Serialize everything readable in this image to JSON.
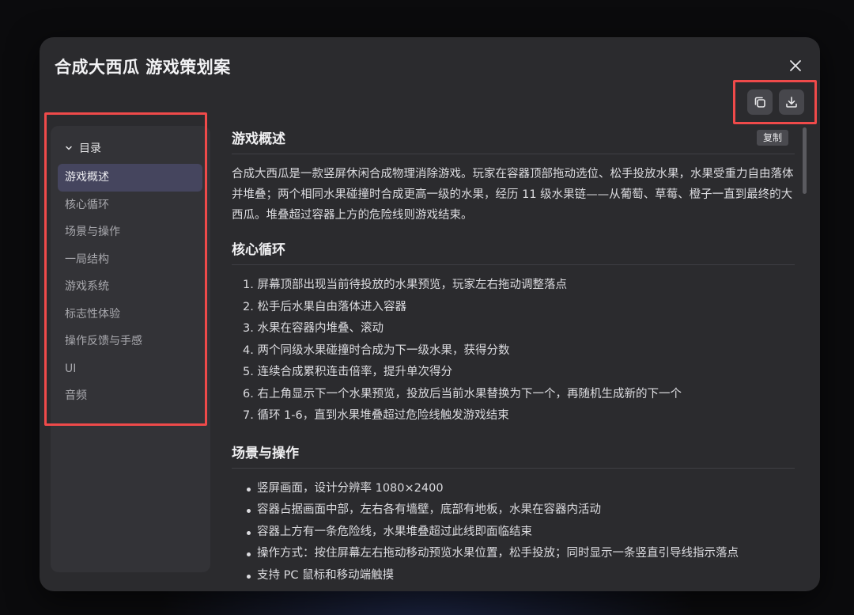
{
  "modal": {
    "title": "合成大西瓜 游戏策划案",
    "close_icon": "close-icon",
    "copy_icon": "copy-icon",
    "download_icon": "download-icon",
    "tooltip": "复制"
  },
  "toc": {
    "header": "目录",
    "items": [
      "游戏概述",
      "核心循环",
      "场景与操作",
      "一局结构",
      "游戏系统",
      "标志性体验",
      "操作反馈与手感",
      "UI",
      "音频"
    ],
    "active_index": 0
  },
  "content": {
    "sections": [
      {
        "heading": "游戏概述",
        "paragraph": "合成大西瓜是一款竖屏休闲合成物理消除游戏。玩家在容器顶部拖动选位、松手投放水果，水果受重力自由落体并堆叠；两个相同水果碰撞时合成更高一级的水果，经历 11 级水果链——从葡萄、草莓、橙子一直到最终的大西瓜。堆叠超过容器上方的危险线则游戏结束。"
      },
      {
        "heading": "核心循环",
        "ordered": [
          "1. 屏幕顶部出现当前待投放的水果预览，玩家左右拖动调整落点",
          "2. 松手后水果自由落体进入容器",
          "3. 水果在容器内堆叠、滚动",
          "4. 两个同级水果碰撞时合成为下一级水果，获得分数",
          "5. 连续合成累积连击倍率，提升单次得分",
          "6. 右上角显示下一个水果预览，投放后当前水果替换为下一个，再随机生成新的下一个",
          "7. 循环 1-6，直到水果堆叠超过危险线触发游戏结束"
        ]
      },
      {
        "heading": "场景与操作",
        "bullets": [
          "竖屏画面，设计分辨率 1080×2400",
          "容器占据画面中部，左右各有墙壁，底部有地板，水果在容器内活动",
          "容器上方有一条危险线，水果堆叠超过此线即面临结束",
          "操作方式：按住屏幕左右拖动移动预览水果位置，松手投放；同时显示一条竖直引导线指示落点",
          "支持 PC 鼠标和移动端触摸"
        ]
      }
    ]
  }
}
